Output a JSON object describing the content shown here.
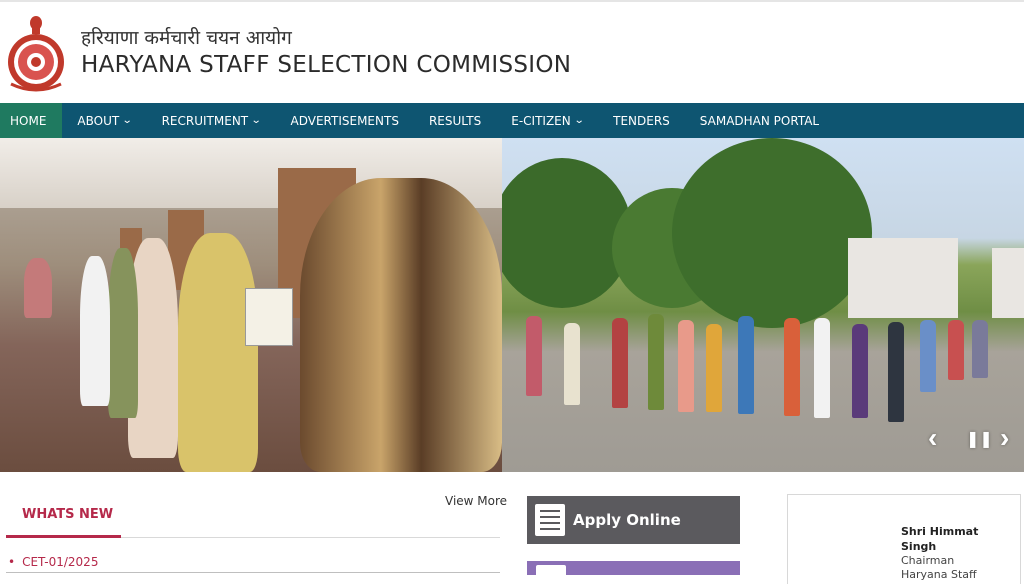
{
  "header": {
    "title_hindi": "हरियाणा कर्मचारी चयन आयोग",
    "title_english": "HARYANA STAFF SELECTION COMMISSION",
    "emblem_icon": "haryana-emblem-icon"
  },
  "nav": {
    "items": [
      {
        "label": "HOME",
        "active": true,
        "dropdown": false
      },
      {
        "label": "ABOUT",
        "active": false,
        "dropdown": true
      },
      {
        "label": "RECRUITMENT",
        "active": false,
        "dropdown": true
      },
      {
        "label": "ADVERTISEMENTS",
        "active": false,
        "dropdown": false
      },
      {
        "label": "RESULTS",
        "active": false,
        "dropdown": false
      },
      {
        "label": "E-CITIZEN",
        "active": false,
        "dropdown": true
      },
      {
        "label": "TENDERS",
        "active": false,
        "dropdown": false
      },
      {
        "label": "SAMADHAN PORTAL",
        "active": false,
        "dropdown": false
      }
    ],
    "dropdown_glyph": "⌄"
  },
  "slider": {
    "prev_glyph": "‹",
    "pause_glyph": "❚❚",
    "next_glyph": "›"
  },
  "whats_new": {
    "title": "WHATS NEW",
    "view_more": "View More",
    "items": [
      {
        "label": "CET-01/2025"
      }
    ]
  },
  "quick_links": {
    "apply_online": "Apply Online"
  },
  "chairman": {
    "name": "Shri Himmat Singh",
    "role": "Chairman",
    "org": "Haryana Staff"
  },
  "colors": {
    "nav_bg": "#0e5571",
    "nav_active": "#1f7a60",
    "accent": "#b5294a",
    "apply_bg": "#5b5a5e"
  }
}
